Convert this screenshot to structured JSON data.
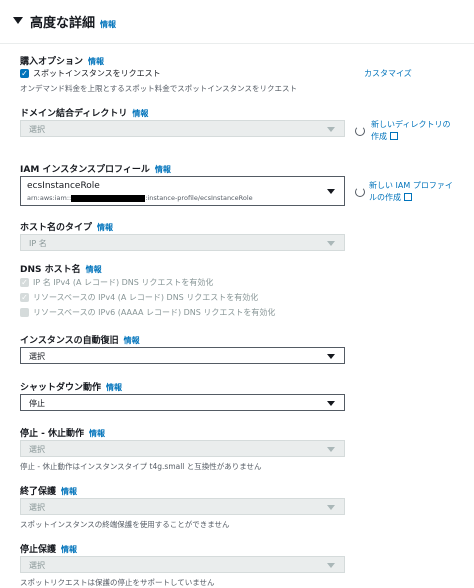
{
  "section": {
    "title": "高度な詳細",
    "info": "情報"
  },
  "purchase": {
    "label": "購入オプション",
    "info": "情報",
    "checkbox_label": "スポットインスタンスをリクエスト",
    "description": "オンデマンド料金を上限とするスポット料金でスポットインスタンスをリクエスト",
    "customize": "カスタマイズ"
  },
  "domain": {
    "label": "ドメイン結合ディレクトリ",
    "info": "情報",
    "value": "選択",
    "link_line1": "新しいディレクトリの",
    "link_line2": "作成"
  },
  "iam": {
    "label": "IAM インスタンスプロフィール",
    "info": "情報",
    "value": "ecsInstanceRole",
    "arn_prefix": "arn:aws:iam::",
    "arn_suffix": ":instance-profile/ecsInstanceRole",
    "link_line1": "新しい IAM プロファイ",
    "link_line2": "ルの作成"
  },
  "hostname": {
    "label": "ホスト名のタイプ",
    "info": "情報",
    "value": "IP 名"
  },
  "dns": {
    "label": "DNS ホスト名",
    "info": "情報",
    "options": [
      "IP 名 IPv4 (A レコード) DNS リクエストを有効化",
      "リソースベースの IPv4 (A レコード) DNS リクエストを有効化",
      "リソースベースの IPv6 (AAAA レコード) DNS リクエストを有効化"
    ]
  },
  "autorecovery": {
    "label": "インスタンスの自動復旧",
    "info": "情報",
    "value": "選択"
  },
  "shutdown": {
    "label": "シャットダウン動作",
    "info": "情報",
    "value": "停止"
  },
  "stop_hibernate": {
    "label": "停止 - 休止動作",
    "info": "情報",
    "value": "選択",
    "description": "停止 - 休止動作はインスタンスタイプ t4g.small と互換性がありません"
  },
  "termination": {
    "label": "終了保護",
    "info": "情報",
    "value": "選択",
    "description": "スポットインスタンスの終端保護を使用することができません"
  },
  "stop_protection": {
    "label": "停止保護",
    "info": "情報",
    "value": "選択",
    "description": "スポットリクエストは保護の停止をサポートしていません"
  }
}
